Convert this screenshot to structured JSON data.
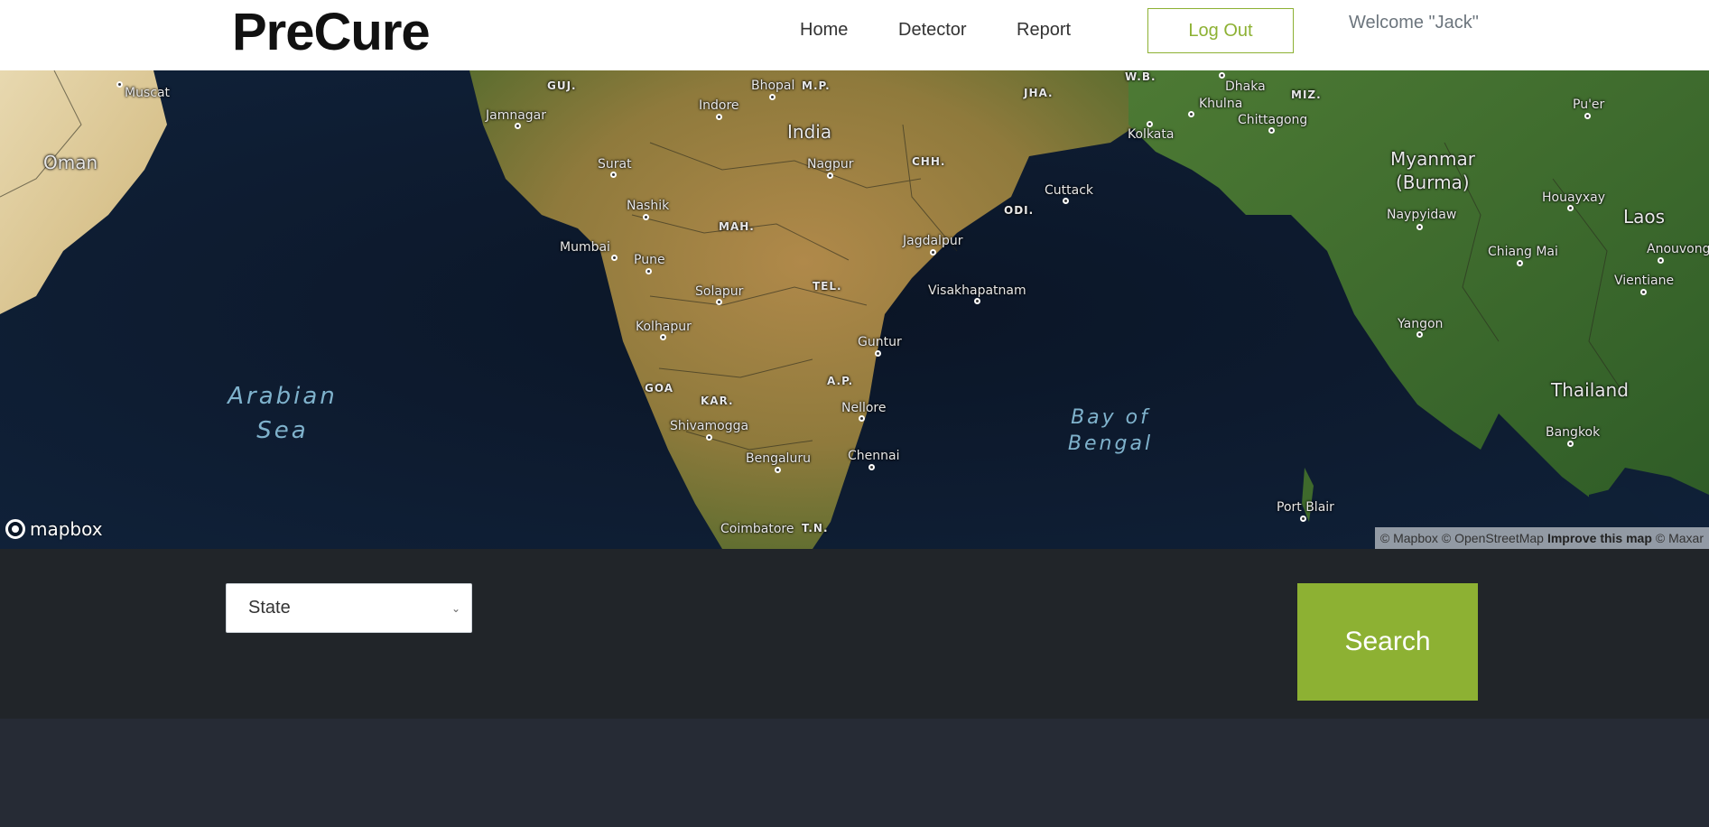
{
  "header": {
    "brand": "PreCure",
    "nav": [
      {
        "label": "Home"
      },
      {
        "label": "Detector"
      },
      {
        "label": "Report"
      }
    ],
    "logout_label": "Log Out",
    "welcome_text": "Welcome \"Jack\""
  },
  "map": {
    "countries": [
      "Oman",
      "India",
      "Myanmar",
      "(Burma)",
      "Laos",
      "Thailand"
    ],
    "seas": {
      "arabian_1": "Arabian",
      "arabian_2": "Sea",
      "bay_1": "Bay of",
      "bay_2": "Bengal"
    },
    "cities": [
      "Muscat",
      "Jamnagar",
      "Bhopal",
      "Indore",
      "Surat",
      "Nagpur",
      "Nashik",
      "Mumbai",
      "Pune",
      "Solapur",
      "Kolhapur",
      "Jagdalpur",
      "Visakhapatnam",
      "Cuttack",
      "Kolkata",
      "Khulna",
      "Dhaka",
      "Chittagong",
      "Guntur",
      "Nellore",
      "Chennai",
      "Bengaluru",
      "Shivamogga",
      "Coimbatore",
      "Port Blair",
      "Naypyidaw",
      "Yangon",
      "Chiang Mai",
      "Houayxay",
      "Vientiane",
      "Anouvong",
      "Bangkok",
      "Pu'er"
    ],
    "states": [
      "GUJ.",
      "M.P.",
      "JHA.",
      "W.B.",
      "MIZ.",
      "CHH.",
      "MAH.",
      "ODI.",
      "TEL.",
      "A.P.",
      "GOA",
      "KAR.",
      "T.N."
    ],
    "logo_text": "mapbox",
    "attribution": {
      "mapbox": "© Mapbox",
      "osm": "© OpenStreetMap",
      "improve": "Improve this map",
      "maxar": "© Maxar"
    }
  },
  "controls": {
    "state_select_value": "State",
    "search_label": "Search"
  }
}
